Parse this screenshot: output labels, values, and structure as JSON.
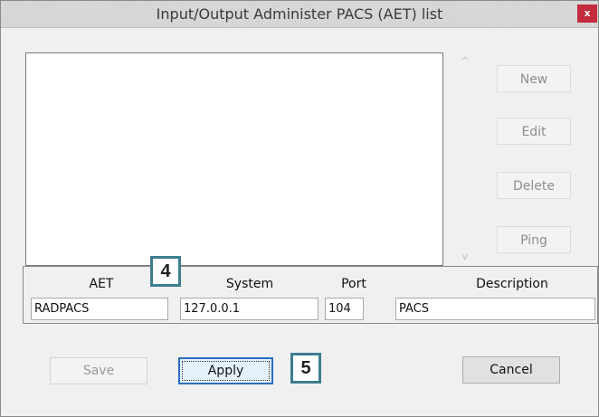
{
  "window": {
    "title": "Input/Output Administer PACS (AET) list",
    "close_glyph": "x"
  },
  "list": {
    "items": [],
    "scroll_up_glyph": "^",
    "scroll_down_glyph": "v"
  },
  "side_buttons": {
    "new_label": "New",
    "edit_label": "Edit",
    "delete_label": "Delete",
    "ping_label": "Ping"
  },
  "fields": {
    "aet_label": "AET",
    "system_label": "System",
    "port_label": "Port",
    "description_label": "Description",
    "aet_value": "RADPACS",
    "system_value": "127.0.0.1",
    "port_value": "104",
    "description_value": "PACS"
  },
  "bottom_buttons": {
    "save_label": "Save",
    "apply_label": "Apply",
    "cancel_label": "Cancel"
  },
  "callouts": {
    "first": "4",
    "second": "5"
  },
  "colors": {
    "close_button": "#c42b3c",
    "callout_border": "#3d7d8f",
    "default_button_border": "#2a6ebd"
  }
}
